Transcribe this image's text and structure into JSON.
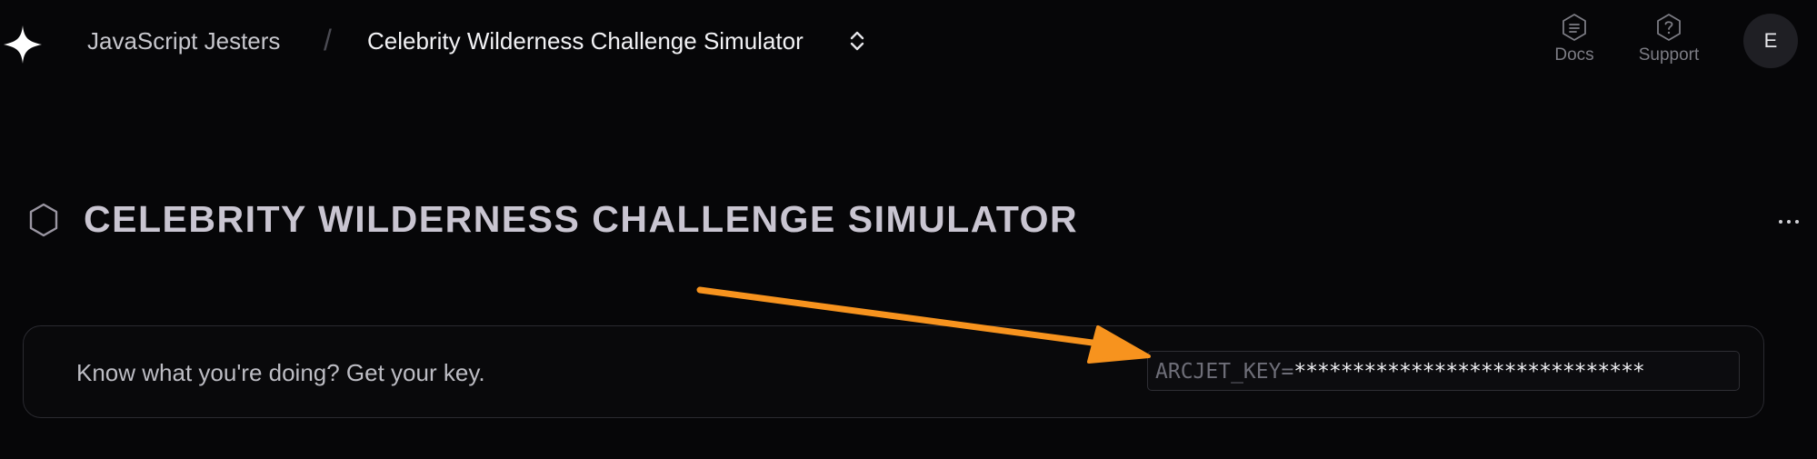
{
  "topbar": {
    "team_name": "JavaScript Jesters",
    "separator": "/",
    "project_name": "Celebrity Wilderness Challenge Simulator",
    "docs_label": "Docs",
    "support_label": "Support",
    "avatar_initial": "E"
  },
  "heading": {
    "title": "CELEBRITY WILDERNESS CHALLENGE SIMULATOR"
  },
  "key_card": {
    "prompt": "Know what you're doing? Get your key.",
    "key_name": "ARCJET_KEY",
    "key_separator": "=",
    "key_value_masked": "******************************"
  },
  "colors": {
    "background": "#060608",
    "annotation_arrow": "#f7931e",
    "title_text": "#c9c5d1"
  },
  "icons": {
    "logo": "sparkle-star-icon",
    "breadcrumb_switcher": "chevron-up-down-icon",
    "docs": "docs-hexagon-icon",
    "support": "help-hexagon-icon",
    "project": "hexagon-outline-icon",
    "menu": "more-horizontal-icon"
  }
}
